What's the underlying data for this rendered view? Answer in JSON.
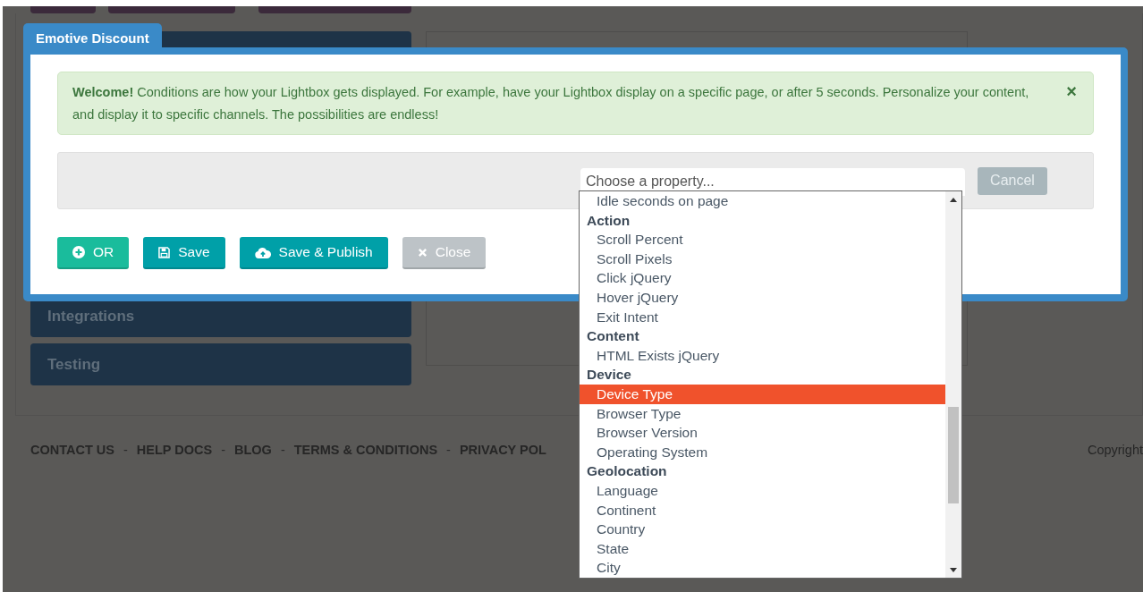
{
  "background": {
    "sidebar_items": [
      "Integrations",
      "Testing"
    ],
    "footer": [
      {
        "kind": "link",
        "text": "CONTACT US"
      },
      {
        "kind": "separator",
        "text": "-"
      },
      {
        "kind": "link",
        "text": "HELP DOCS"
      },
      {
        "kind": "separator",
        "text": "-"
      },
      {
        "kind": "link",
        "text": "BLOG"
      },
      {
        "kind": "separator",
        "text": "-"
      },
      {
        "kind": "link",
        "text": "TERMS & CONDITIONS"
      },
      {
        "kind": "separator",
        "text": "-"
      },
      {
        "kind": "link",
        "text": "PRIVACY POL"
      }
    ],
    "copyright": "Copyright"
  },
  "modal": {
    "tab": "Emotive Discount",
    "alert": {
      "text": "**Welcome!**   Conditions are how your Lightbox gets displayed. For example, have your Lightbox display on a specific page, or after 5 seconds. Personalize your content, and display it to specific channels. The possibilities are endless!",
      "close": "×"
    },
    "property_select": {
      "placeholder": "Choose a property..."
    },
    "cancel_button": {
      "label": "Cancel",
      "disabled": true
    },
    "buttons": [
      {
        "label": "OR",
        "kind": "add",
        "disabled": false
      },
      {
        "label": "Save",
        "kind": "save",
        "disabled": false
      },
      {
        "label": "Save & Publish",
        "kind": "publish",
        "disabled": false
      },
      {
        "label": "Close",
        "kind": "close",
        "disabled": true
      }
    ],
    "dropdown": {
      "options": [
        {
          "kind": "option",
          "label": "Idle seconds on page",
          "selected": false
        },
        {
          "kind": "group",
          "label": "Action"
        },
        {
          "kind": "option",
          "label": "Scroll Percent",
          "selected": false
        },
        {
          "kind": "option",
          "label": "Scroll Pixels",
          "selected": false
        },
        {
          "kind": "option",
          "label": "Click jQuery",
          "selected": false
        },
        {
          "kind": "option",
          "label": "Hover jQuery",
          "selected": false
        },
        {
          "kind": "option",
          "label": "Exit Intent",
          "selected": false
        },
        {
          "kind": "group",
          "label": "Content"
        },
        {
          "kind": "option",
          "label": "HTML Exists jQuery",
          "selected": false
        },
        {
          "kind": "group",
          "label": "Device"
        },
        {
          "kind": "option",
          "label": "Device Type",
          "selected": true
        },
        {
          "kind": "option",
          "label": "Browser Type",
          "selected": false
        },
        {
          "kind": "option",
          "label": "Browser Version",
          "selected": false
        },
        {
          "kind": "option",
          "label": "Operating System",
          "selected": false
        },
        {
          "kind": "group",
          "label": "Geolocation"
        },
        {
          "kind": "option",
          "label": "Language",
          "selected": false
        },
        {
          "kind": "option",
          "label": "Continent",
          "selected": false
        },
        {
          "kind": "option",
          "label": "Country",
          "selected": false
        },
        {
          "kind": "option",
          "label": "State",
          "selected": false
        },
        {
          "kind": "option",
          "label": "City",
          "selected": false
        }
      ]
    }
  }
}
